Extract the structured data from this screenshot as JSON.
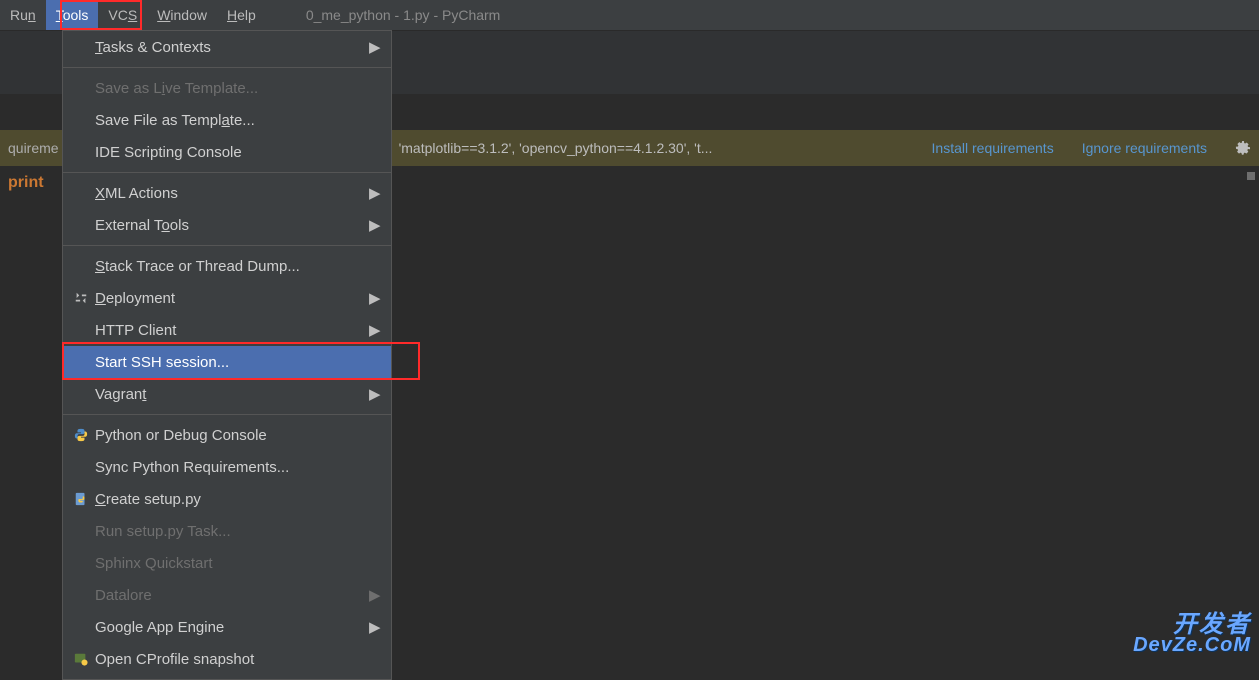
{
  "menubar": {
    "items": [
      {
        "pre": "Ru",
        "u": "n",
        "post": ""
      },
      {
        "pre": "",
        "u": "T",
        "post": "ools"
      },
      {
        "pre": "VC",
        "u": "S",
        "post": ""
      },
      {
        "pre": "",
        "u": "W",
        "post": "indow"
      },
      {
        "pre": "",
        "u": "H",
        "post": "elp"
      }
    ],
    "title": "0_me_python - 1.py - PyCharm"
  },
  "notice": {
    "left": "quireme",
    "mid": "'matplotlib==3.1.2', 'opencv_python==4.1.2.30', 't...",
    "install": "Install requirements",
    "ignore": "Ignore requirements"
  },
  "editor": {
    "line1": "print"
  },
  "menu": {
    "tasks": {
      "pre": "",
      "u": "T",
      "post": "asks & Contexts"
    },
    "save_live": {
      "pre": "Save as L",
      "u": "i",
      "post": "ve Template..."
    },
    "save_file": {
      "pre": "Save File as Templ",
      "u": "a",
      "post": "te..."
    },
    "ide_script": "IDE Scripting Console",
    "xml": {
      "pre": "",
      "u": "X",
      "post": "ML Actions"
    },
    "external": {
      "pre": "External T",
      "u": "o",
      "post": "ols"
    },
    "stacktrace": {
      "pre": "",
      "u": "S",
      "post": "tack Trace or Thread Dump..."
    },
    "deployment": {
      "pre": "",
      "u": "D",
      "post": "eployment"
    },
    "http": "HTTP Client",
    "ssh": "Start SSH session...",
    "vagrant": {
      "pre": "Vagran",
      "u": "t",
      "post": ""
    },
    "py_console": "Python or Debug Console",
    "sync_req": "Sync Python Requirements...",
    "create_setup": {
      "pre": "",
      "u": "C",
      "post": "reate setup.py"
    },
    "run_setup": "Run setup.py Task...",
    "sphinx": "Sphinx Quickstart",
    "datalore": "Datalore",
    "gae": "Google App Engine",
    "cprofile": "Open CProfile snapshot"
  },
  "watermark": {
    "l1": "开发者",
    "l2": "DevZe.CoM"
  }
}
